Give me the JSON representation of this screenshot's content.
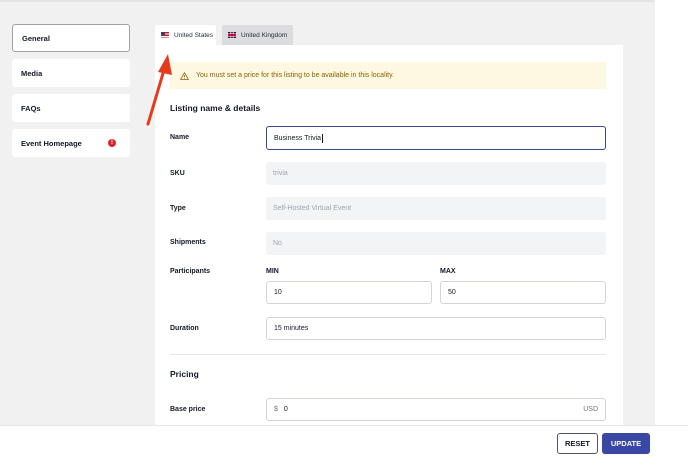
{
  "sidebar": {
    "items": [
      {
        "label": "General"
      },
      {
        "label": "Media"
      },
      {
        "label": "FAQs"
      },
      {
        "label": "Event Homepage",
        "badge": "!"
      }
    ]
  },
  "tabs": [
    {
      "label": "United States",
      "flag": "us-flag-icon"
    },
    {
      "label": "United Kingdom",
      "flag": "uk-flag-icon"
    }
  ],
  "alert": {
    "text": "You must set a price for this listing to be available in this locality.",
    "icon": "warning-icon"
  },
  "listing": {
    "section_title": "Listing name & details",
    "name_label": "Name",
    "name_value": "Business Trivia",
    "sku_label": "SKU",
    "sku_value": "trivia",
    "type_label": "Type",
    "type_value": "Self-Hosted Virtual Event",
    "shipments_label": "Shipments",
    "shipments_value": "No",
    "participants_label": "Participants",
    "min_label": "MIN",
    "min_value": "10",
    "max_label": "MAX",
    "max_value": "50",
    "duration_label": "Duration",
    "duration_value": "15 minutes"
  },
  "pricing": {
    "section_title": "Pricing",
    "base_price_label": "Base price",
    "currency_symbol": "$",
    "base_price_value": "0",
    "currency_code": "USD"
  },
  "footer": {
    "reset_label": "RESET",
    "update_label": "UPDATE"
  },
  "colors": {
    "accent": "#3a47a5",
    "error": "#dc2626",
    "alert_bg": "#fdf8e1",
    "annotation_arrow": "#e63a1c"
  }
}
